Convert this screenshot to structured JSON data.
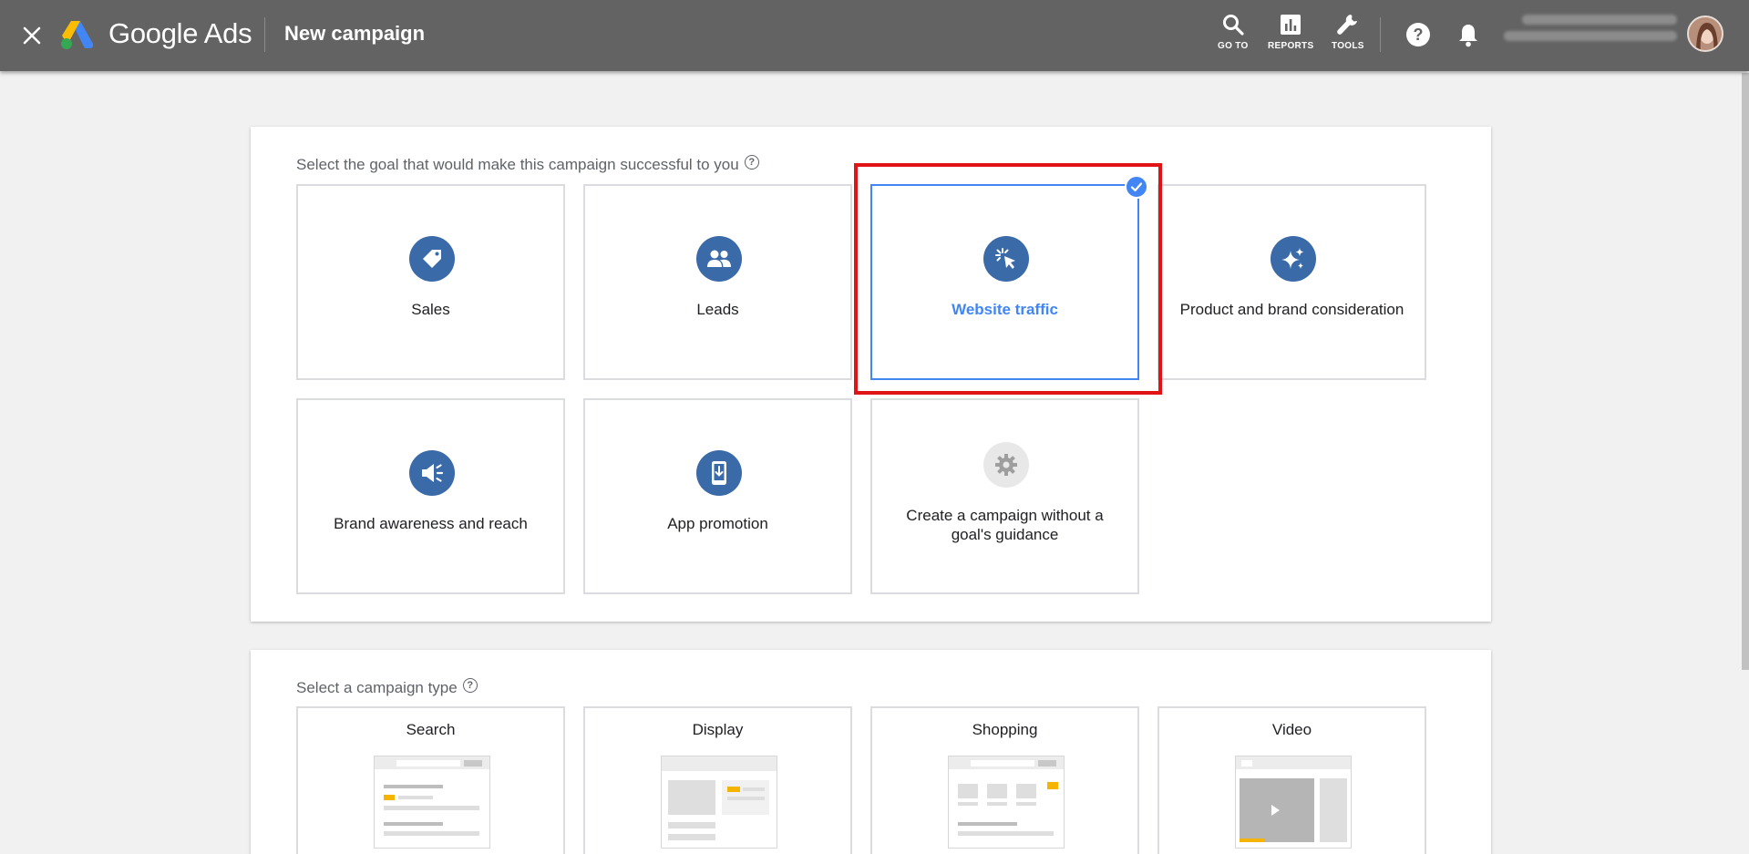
{
  "header": {
    "close_icon": "close-icon",
    "brand_name": "Google Ads",
    "page_title": "New campaign",
    "actions": [
      {
        "label": "GO TO",
        "icon": "search-icon"
      },
      {
        "label": "REPORTS",
        "icon": "bar-chart-icon"
      },
      {
        "label": "TOOLS",
        "icon": "wrench-icon"
      }
    ],
    "help_icon": "help-icon",
    "notifications_icon": "bell-icon"
  },
  "goals": {
    "prompt": "Select the goal that would make this campaign successful to you",
    "items": [
      {
        "label": "Sales",
        "icon": "price-tag-icon",
        "selected": false
      },
      {
        "label": "Leads",
        "icon": "people-icon",
        "selected": false
      },
      {
        "label": "Website traffic",
        "icon": "cursor-click-icon",
        "selected": true
      },
      {
        "label": "Product and brand consideration",
        "icon": "sparkle-icon",
        "selected": false
      },
      {
        "label": "Brand awareness and reach",
        "icon": "megaphone-icon",
        "selected": false
      },
      {
        "label": "App promotion",
        "icon": "phone-download-icon",
        "selected": false
      },
      {
        "label": "Create a campaign without a goal's guidance",
        "icon": "gear-icon",
        "selected": false
      }
    ]
  },
  "campaign_types": {
    "prompt": "Select a campaign type",
    "items": [
      {
        "label": "Search"
      },
      {
        "label": "Display"
      },
      {
        "label": "Shopping"
      },
      {
        "label": "Video"
      }
    ]
  },
  "colors": {
    "header_bg": "#636363",
    "accent_blue": "#4285f4",
    "goal_icon_bg": "#3a6aa8",
    "highlight_red": "#e01414",
    "placeholder_yellow": "#f4b400"
  }
}
